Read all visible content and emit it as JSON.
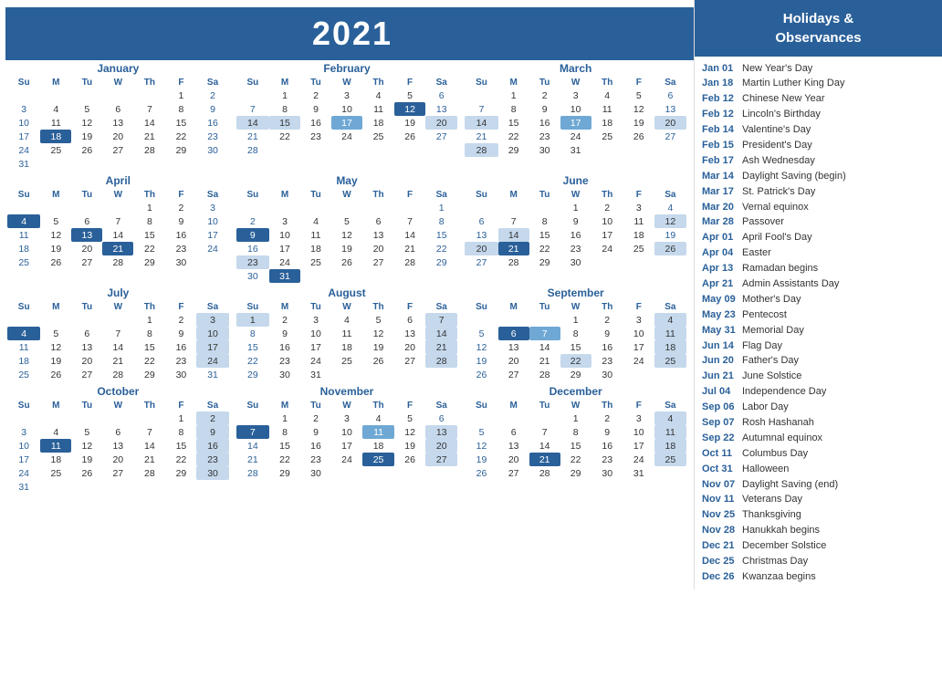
{
  "header": {
    "year": "2021",
    "sidebar_title": "Holidays &\nObservances"
  },
  "holidays": [
    {
      "date": "Jan 01",
      "name": "New Year's Day"
    },
    {
      "date": "Jan 18",
      "name": "Martin Luther King Day"
    },
    {
      "date": "Feb 12",
      "name": "Chinese New Year"
    },
    {
      "date": "Feb 12",
      "name": "Lincoln's Birthday"
    },
    {
      "date": "Feb 14",
      "name": "Valentine's Day"
    },
    {
      "date": "Feb 15",
      "name": "President's Day"
    },
    {
      "date": "Feb 17",
      "name": "Ash Wednesday"
    },
    {
      "date": "Mar 14",
      "name": "Daylight Saving (begin)"
    },
    {
      "date": "Mar 17",
      "name": "St. Patrick's Day"
    },
    {
      "date": "Mar 20",
      "name": "Vernal equinox"
    },
    {
      "date": "Mar 28",
      "name": "Passover"
    },
    {
      "date": "Apr 01",
      "name": "April Fool's Day"
    },
    {
      "date": "Apr 04",
      "name": "Easter"
    },
    {
      "date": "Apr 13",
      "name": "Ramadan begins"
    },
    {
      "date": "Apr 21",
      "name": "Admin Assistants Day"
    },
    {
      "date": "May 09",
      "name": "Mother's Day"
    },
    {
      "date": "May 23",
      "name": "Pentecost"
    },
    {
      "date": "May 31",
      "name": "Memorial Day"
    },
    {
      "date": "Jun 14",
      "name": "Flag Day"
    },
    {
      "date": "Jun 20",
      "name": "Father's Day"
    },
    {
      "date": "Jun 21",
      "name": "June Solstice"
    },
    {
      "date": "Jul 04",
      "name": "Independence Day"
    },
    {
      "date": "Sep 06",
      "name": "Labor Day"
    },
    {
      "date": "Sep 07",
      "name": "Rosh Hashanah"
    },
    {
      "date": "Sep 22",
      "name": "Autumnal equinox"
    },
    {
      "date": "Oct 11",
      "name": "Columbus Day"
    },
    {
      "date": "Oct 31",
      "name": "Halloween"
    },
    {
      "date": "Nov 07",
      "name": "Daylight Saving (end)"
    },
    {
      "date": "Nov 11",
      "name": "Veterans Day"
    },
    {
      "date": "Nov 25",
      "name": "Thanksgiving"
    },
    {
      "date": "Nov 28",
      "name": "Hanukkah begins"
    },
    {
      "date": "Dec 21",
      "name": "December Solstice"
    },
    {
      "date": "Dec 25",
      "name": "Christmas Day"
    },
    {
      "date": "Dec 26",
      "name": "Kwanzaa begins"
    }
  ],
  "months": [
    {
      "name": "January",
      "weeks": [
        [
          null,
          null,
          null,
          null,
          null,
          "1",
          "2"
        ],
        [
          "3",
          "4",
          "5",
          "6",
          "7",
          "8",
          "9"
        ],
        [
          "10",
          "11",
          "12",
          "13",
          "14",
          "15",
          "16"
        ],
        [
          "17",
          "18",
          "19",
          "20",
          "21",
          "22",
          "23"
        ],
        [
          "24",
          "25",
          "26",
          "27",
          "28",
          "29",
          "30"
        ],
        [
          "31",
          null,
          null,
          null,
          null,
          null,
          null
        ]
      ],
      "highlights": {
        "18": "blue",
        "1": "light-end",
        "2": "sa-normal"
      }
    },
    {
      "name": "February",
      "weeks": [
        [
          null,
          "1",
          "2",
          "3",
          "4",
          "5",
          "6"
        ],
        [
          "7",
          "8",
          "9",
          "10",
          "11",
          "12",
          "13"
        ],
        [
          "14",
          "15",
          "16",
          "17",
          "18",
          "19",
          "20"
        ],
        [
          "21",
          "22",
          "23",
          "24",
          "25",
          "26",
          "27"
        ],
        [
          "28",
          null,
          null,
          null,
          null,
          null,
          null
        ]
      ],
      "highlights": {
        "12": "blue",
        "14": "light",
        "15": "light",
        "17": "mid",
        "20": "light"
      }
    },
    {
      "name": "March",
      "weeks": [
        [
          null,
          "1",
          "2",
          "3",
          "4",
          "5",
          "6"
        ],
        [
          "7",
          "8",
          "9",
          "10",
          "11",
          "12",
          "13"
        ],
        [
          "14",
          "15",
          "16",
          "17",
          "18",
          "19",
          "20"
        ],
        [
          "21",
          "22",
          "23",
          "24",
          "25",
          "26",
          "27"
        ],
        [
          "28",
          "29",
          "30",
          "31",
          null,
          null,
          null
        ]
      ],
      "highlights": {
        "14": "light",
        "17": "mid",
        "20": "light",
        "28": "light",
        "6": "light",
        "13": "light"
      }
    },
    {
      "name": "April",
      "weeks": [
        [
          null,
          null,
          null,
          null,
          "1",
          "2",
          "3"
        ],
        [
          "4",
          "5",
          "6",
          "7",
          "8",
          "9",
          "10"
        ],
        [
          "11",
          "12",
          "13",
          "14",
          "15",
          "16",
          "17"
        ],
        [
          "18",
          "19",
          "20",
          "21",
          "22",
          "23",
          "24"
        ],
        [
          "25",
          "26",
          "27",
          "28",
          "29",
          "30",
          null
        ]
      ],
      "highlights": {
        "4": "blue",
        "13": "blue",
        "21": "blue"
      }
    },
    {
      "name": "May",
      "weeks": [
        [
          null,
          null,
          null,
          null,
          null,
          null,
          "1"
        ],
        [
          "2",
          "3",
          "4",
          "5",
          "6",
          "7",
          "8"
        ],
        [
          "9",
          "10",
          "11",
          "12",
          "13",
          "14",
          "15"
        ],
        [
          "16",
          "17",
          "18",
          "19",
          "20",
          "21",
          "22"
        ],
        [
          "23",
          "24",
          "25",
          "26",
          "27",
          "28",
          "29"
        ],
        [
          "30",
          "31",
          null,
          null,
          null,
          null,
          null
        ]
      ],
      "highlights": {
        "9": "blue",
        "23": "light",
        "31": "blue"
      }
    },
    {
      "name": "June",
      "weeks": [
        [
          null,
          null,
          null,
          "1",
          "2",
          "3",
          "4"
        ],
        [
          "6",
          "7",
          "8",
          "9",
          "10",
          "11",
          "12"
        ],
        [
          "13",
          "14",
          "15",
          "16",
          "17",
          "18",
          "19"
        ],
        [
          "20",
          "21",
          "22",
          "23",
          "24",
          "25",
          "26"
        ],
        [
          "27",
          "28",
          "29",
          "30",
          null,
          null,
          null
        ]
      ],
      "highlights": {
        "5": "light",
        "12": "light",
        "14": "light",
        "20": "light",
        "21": "blue",
        "26": "light"
      }
    },
    {
      "name": "July",
      "weeks": [
        [
          null,
          null,
          null,
          null,
          "1",
          "2",
          "3"
        ],
        [
          "4",
          "5",
          "6",
          "7",
          "8",
          "9",
          "10"
        ],
        [
          "11",
          "12",
          "13",
          "14",
          "15",
          "16",
          "17"
        ],
        [
          "18",
          "19",
          "20",
          "21",
          "22",
          "23",
          "24"
        ],
        [
          "25",
          "26",
          "27",
          "28",
          "29",
          "30",
          "31"
        ]
      ],
      "highlights": {
        "4": "blue",
        "3": "light",
        "10": "light",
        "17": "light",
        "24": "light"
      }
    },
    {
      "name": "August",
      "weeks": [
        [
          "1",
          "2",
          "3",
          "4",
          "5",
          "6",
          "7"
        ],
        [
          "8",
          "9",
          "10",
          "11",
          "12",
          "13",
          "14"
        ],
        [
          "15",
          "16",
          "17",
          "18",
          "19",
          "20",
          "21"
        ],
        [
          "22",
          "23",
          "24",
          "25",
          "26",
          "27",
          "28"
        ],
        [
          "29",
          "30",
          "31",
          null,
          null,
          null,
          null
        ]
      ],
      "highlights": {
        "1": "light",
        "7": "light",
        "14": "light",
        "21": "light",
        "28": "light"
      }
    },
    {
      "name": "September",
      "weeks": [
        [
          null,
          null,
          null,
          "1",
          "2",
          "3",
          "4"
        ],
        [
          "5",
          "6",
          "7",
          "8",
          "9",
          "10",
          "11"
        ],
        [
          "12",
          "13",
          "14",
          "15",
          "16",
          "17",
          "18"
        ],
        [
          "19",
          "20",
          "21",
          "22",
          "23",
          "24",
          "25"
        ],
        [
          "26",
          "27",
          "28",
          "29",
          "30",
          null,
          null
        ]
      ],
      "highlights": {
        "4": "light",
        "6": "blue",
        "7": "mid",
        "11": "light",
        "18": "light",
        "22": "light",
        "25": "light"
      }
    },
    {
      "name": "October",
      "weeks": [
        [
          null,
          null,
          null,
          null,
          null,
          "1",
          "2"
        ],
        [
          "3",
          "4",
          "5",
          "6",
          "7",
          "8",
          "9"
        ],
        [
          "10",
          "11",
          "12",
          "13",
          "14",
          "15",
          "16"
        ],
        [
          "17",
          "18",
          "19",
          "20",
          "21",
          "22",
          "23"
        ],
        [
          "24",
          "25",
          "26",
          "27",
          "28",
          "29",
          "30"
        ],
        [
          "31",
          null,
          null,
          null,
          null,
          null,
          null
        ]
      ],
      "highlights": {
        "11": "blue",
        "2": "light",
        "9": "light",
        "16": "light",
        "23": "light",
        "30": "light"
      }
    },
    {
      "name": "November",
      "weeks": [
        [
          null,
          "1",
          "2",
          "3",
          "4",
          "5",
          "6"
        ],
        [
          "7",
          "8",
          "9",
          "10",
          "11",
          "12",
          "13"
        ],
        [
          "14",
          "15",
          "16",
          "17",
          "18",
          "19",
          "20"
        ],
        [
          "21",
          "22",
          "23",
          "24",
          "25",
          "26",
          "27"
        ],
        [
          "28",
          "29",
          "30",
          null,
          null,
          null,
          null
        ]
      ],
      "highlights": {
        "7": "blue",
        "11": "mid",
        "13": "light",
        "20": "light",
        "25": "blue",
        "27": "light"
      }
    },
    {
      "name": "December",
      "weeks": [
        [
          null,
          null,
          null,
          "1",
          "2",
          "3",
          "4"
        ],
        [
          "5",
          "6",
          "7",
          "8",
          "9",
          "10",
          "11"
        ],
        [
          "12",
          "13",
          "14",
          "15",
          "16",
          "17",
          "18"
        ],
        [
          "19",
          "20",
          "21",
          "22",
          "23",
          "24",
          "25"
        ],
        [
          "26",
          "27",
          "28",
          "29",
          "30",
          "31",
          null
        ]
      ],
      "highlights": {
        "4": "light",
        "11": "light",
        "18": "light",
        "21": "blue",
        "25": "light"
      }
    }
  ],
  "day_headers": [
    "Su",
    "M",
    "Tu",
    "W",
    "Th",
    "F",
    "Sa"
  ]
}
